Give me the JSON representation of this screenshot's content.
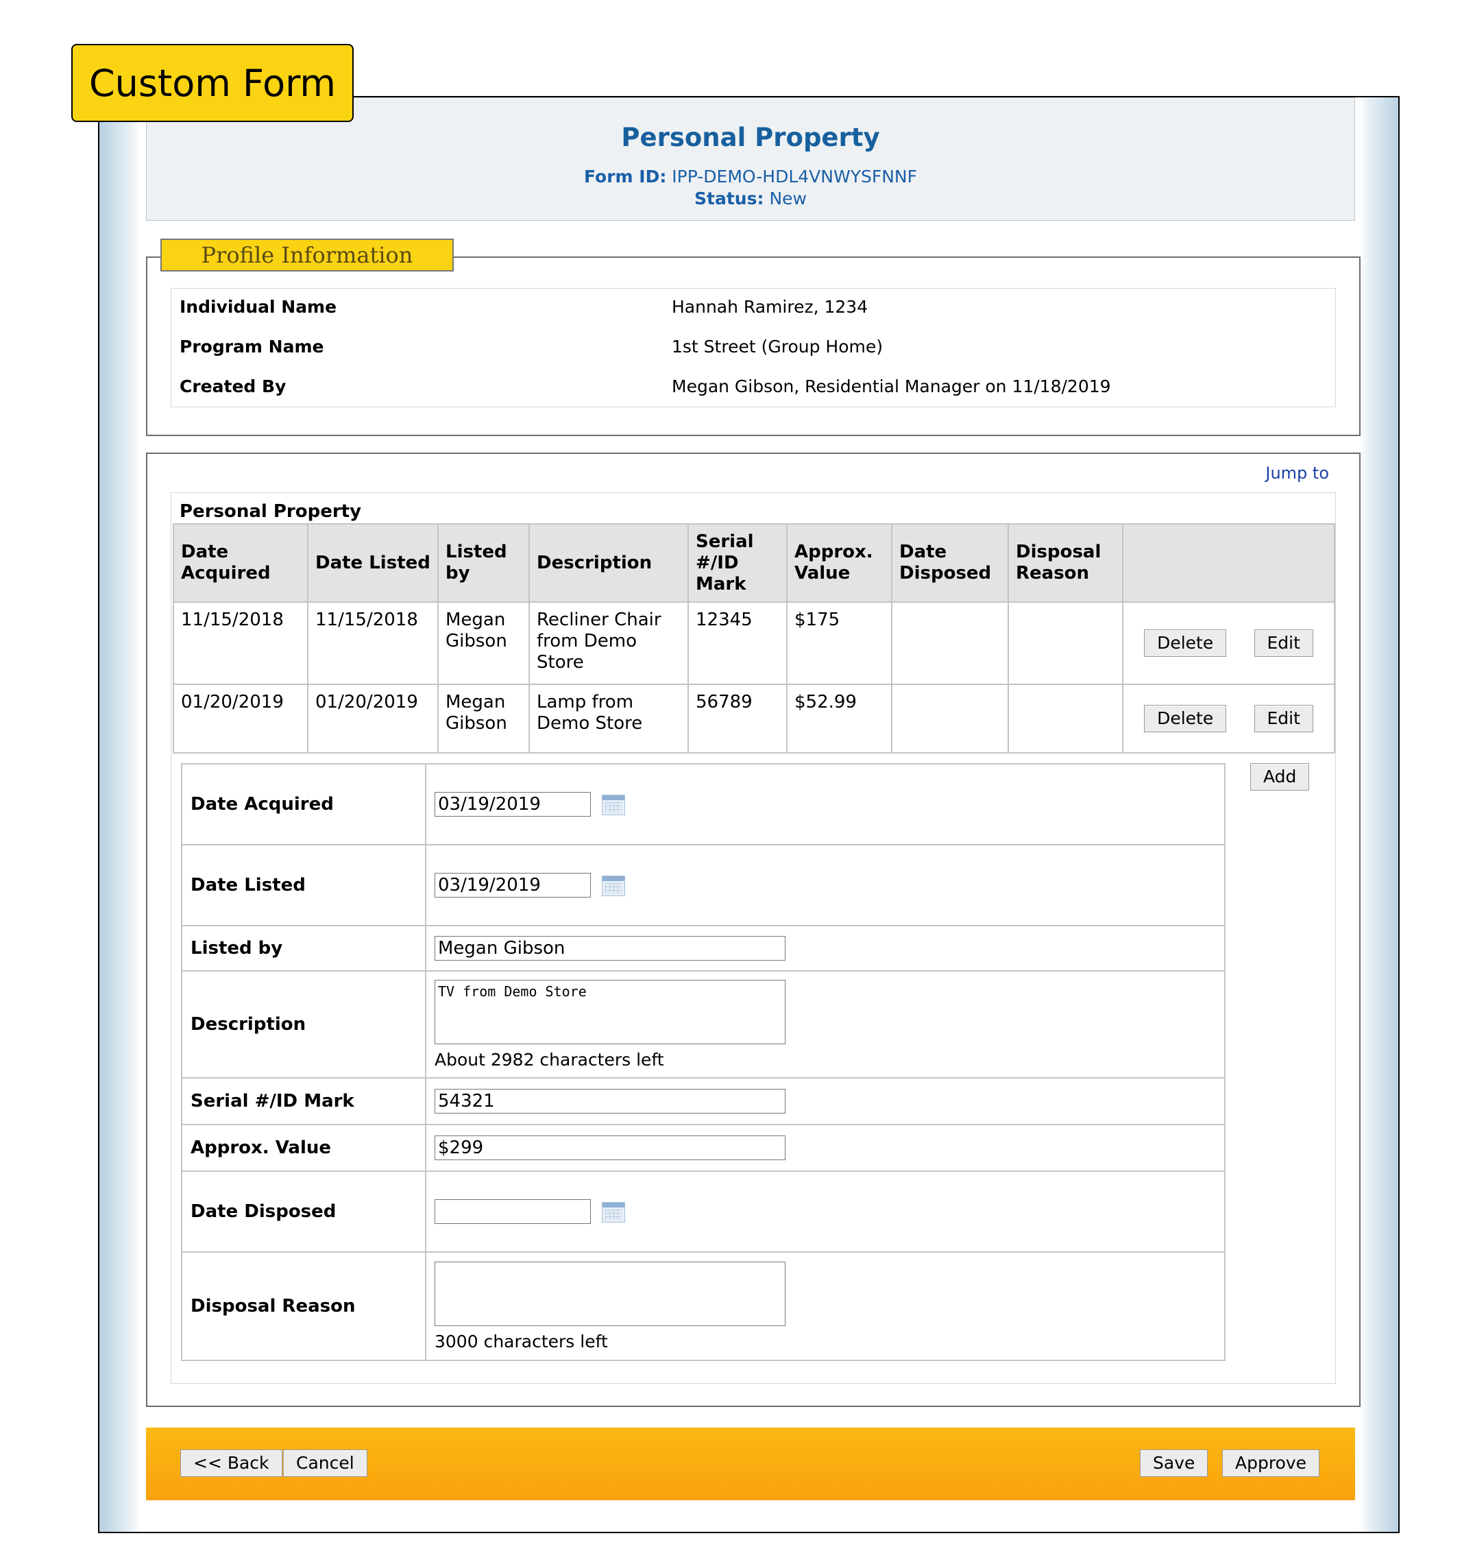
{
  "callout": "Custom Form",
  "header": {
    "title": "Personal Property",
    "form_id_label": "Form ID:",
    "form_id": "IPP-DEMO-HDL4VNWYSFNNF",
    "status_label": "Status:",
    "status": "New"
  },
  "profile": {
    "legend": "Profile Information",
    "rows": [
      {
        "label": "Individual Name",
        "value": "Hannah Ramirez, 1234"
      },
      {
        "label": "Program Name",
        "value": "1st Street (Group Home)"
      },
      {
        "label": "Created By",
        "value": "Megan Gibson, Residential Manager on 11/18/2019"
      }
    ]
  },
  "property": {
    "jump_to": "Jump to",
    "caption": "Personal Property",
    "columns": [
      "Date Acquired",
      "Date Listed",
      "Listed by",
      "Description",
      "Serial #/ID Mark",
      "Approx. Value",
      "Date Disposed",
      "Disposal Reason"
    ],
    "rows": [
      {
        "date_acquired": "11/15/2018",
        "date_listed": "11/15/2018",
        "listed_by": "Megan Gibson",
        "description": "Recliner Chair from Demo Store",
        "serial": "12345",
        "value": "$175",
        "date_disposed": "",
        "disposal_reason": ""
      },
      {
        "date_acquired": "01/20/2019",
        "date_listed": "01/20/2019",
        "listed_by": "Megan Gibson",
        "description": "Lamp from Demo Store",
        "serial": "56789",
        "value": "$52.99",
        "date_disposed": "",
        "disposal_reason": ""
      }
    ],
    "delete_label": "Delete",
    "edit_label": "Edit",
    "add_label": "Add"
  },
  "form": {
    "date_acquired_label": "Date Acquired",
    "date_acquired": "03/19/2019",
    "date_listed_label": "Date Listed",
    "date_listed": "03/19/2019",
    "listed_by_label": "Listed by",
    "listed_by": "Megan Gibson",
    "description_label": "Description",
    "description": "TV from Demo Store",
    "description_note": "About 2982 characters left",
    "serial_label": "Serial #/ID Mark",
    "serial": "54321",
    "value_label": "Approx. Value",
    "value": "$299",
    "date_disposed_label": "Date Disposed",
    "date_disposed": "",
    "disposal_reason_label": "Disposal Reason",
    "disposal_reason": "",
    "disposal_note": "3000 characters left"
  },
  "footer": {
    "back": "<< Back",
    "cancel": "Cancel",
    "save": "Save",
    "approve": "Approve"
  }
}
